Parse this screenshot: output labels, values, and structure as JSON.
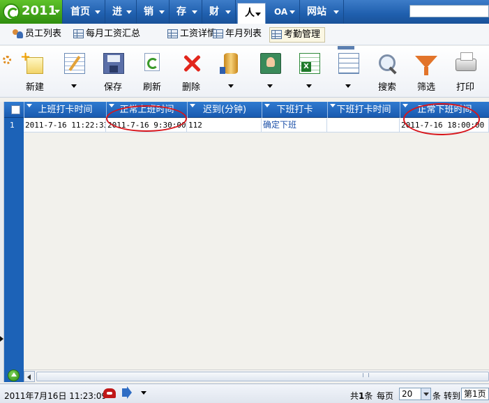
{
  "logo": {
    "year": "2011"
  },
  "nav": {
    "items": [
      {
        "label": "首页"
      },
      {
        "label": "进"
      },
      {
        "label": "销"
      },
      {
        "label": "存"
      },
      {
        "label": "财"
      },
      {
        "label": "人",
        "active": true
      },
      {
        "label": "OA"
      },
      {
        "label": "网站"
      }
    ],
    "search_value": ""
  },
  "subtabs": [
    {
      "label": "员工列表",
      "icon": "users-icon"
    },
    {
      "label": "每月工资汇总",
      "icon": "table-icon"
    },
    {
      "label": "工资详情",
      "icon": "table-icon"
    },
    {
      "label": "年月列表",
      "icon": "table-icon"
    },
    {
      "label": "考勤管理",
      "icon": "table-icon",
      "active": true
    }
  ],
  "toolbar": {
    "new": "新建",
    "save": "保存",
    "refresh": "刷新",
    "delete": "删除",
    "search": "搜索",
    "filter": "筛选",
    "print": "打印"
  },
  "grid": {
    "columns": [
      "上班打卡时间",
      "正常上班时间",
      "迟到(分钟)",
      "下班打卡",
      "下班打卡时间",
      "正常下班时间"
    ],
    "rows": [
      {
        "num": "1",
        "checkin_time": "2011-7-16 11:22:33",
        "normal_start": "2011-7-16 9:30:00",
        "late_minutes": "112",
        "checkout": "确定下班",
        "checkout_time": "",
        "normal_end": "2011-7-16 18:00:00"
      }
    ],
    "highlight_color": "#d8151b"
  },
  "status": {
    "clock": "2011年7月16日 11:23:09",
    "total_prefix": "共",
    "total_count": "1",
    "total_suffix": "条",
    "per_page_label": "每页",
    "per_page_value": "20",
    "per_page_unit": "条",
    "goto_label": "转到",
    "page_value": "第1页"
  },
  "colors": {
    "accent": "#1f5fae",
    "header": "#1c62b7",
    "link": "#1b4fa8"
  }
}
